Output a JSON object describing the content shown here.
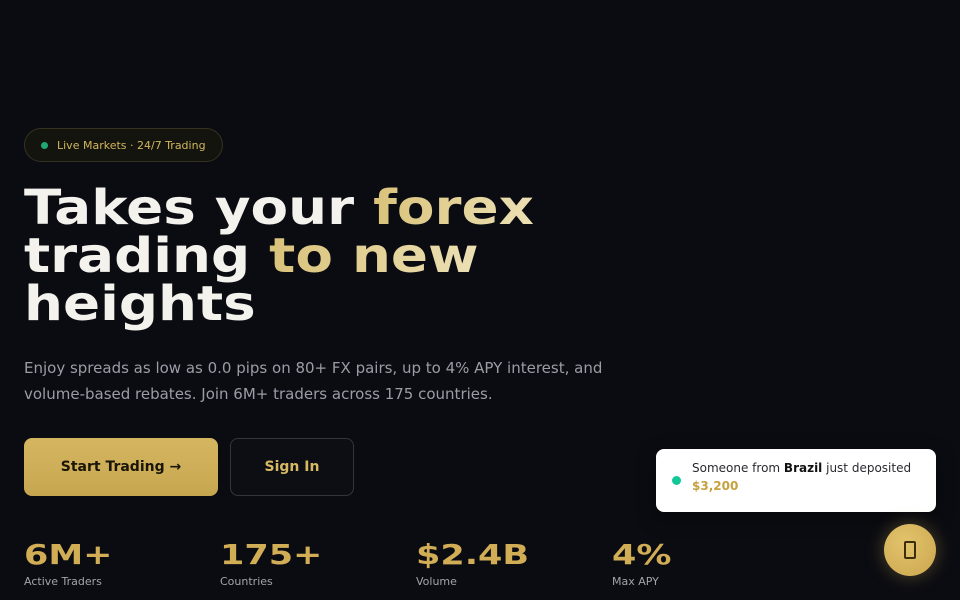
{
  "badge": {
    "text": "Live Markets · 24/7 Trading"
  },
  "hero": {
    "line1_a": "Takes your ",
    "line1_b": "forex",
    "line2_a": "trading ",
    "line2_b": "to new",
    "line3": "heights",
    "subtitle": "Enjoy spreads as low as 0.0 pips on 80+ FX pairs, up to 4% APY interest, and volume-based rebates. Join 6M+ traders across 175 countries."
  },
  "buttons": {
    "primary": "Start Trading →",
    "secondary": "Sign In"
  },
  "stats": [
    {
      "value": "6M+",
      "label": "Active Traders"
    },
    {
      "value": "175+",
      "label": "Countries"
    },
    {
      "value": "$2.4B",
      "label": "Volume"
    },
    {
      "value": "4%",
      "label": "Max APY"
    }
  ],
  "toast": {
    "prefix": "Someone from ",
    "country": "Brazil",
    "suffix": " just deposited",
    "amount": "$3,200"
  },
  "colors": {
    "accent": "#d1ae55",
    "background": "#0b0c12",
    "live_dot": "#1fa876"
  },
  "icons": {
    "fab": "chat-icon"
  }
}
